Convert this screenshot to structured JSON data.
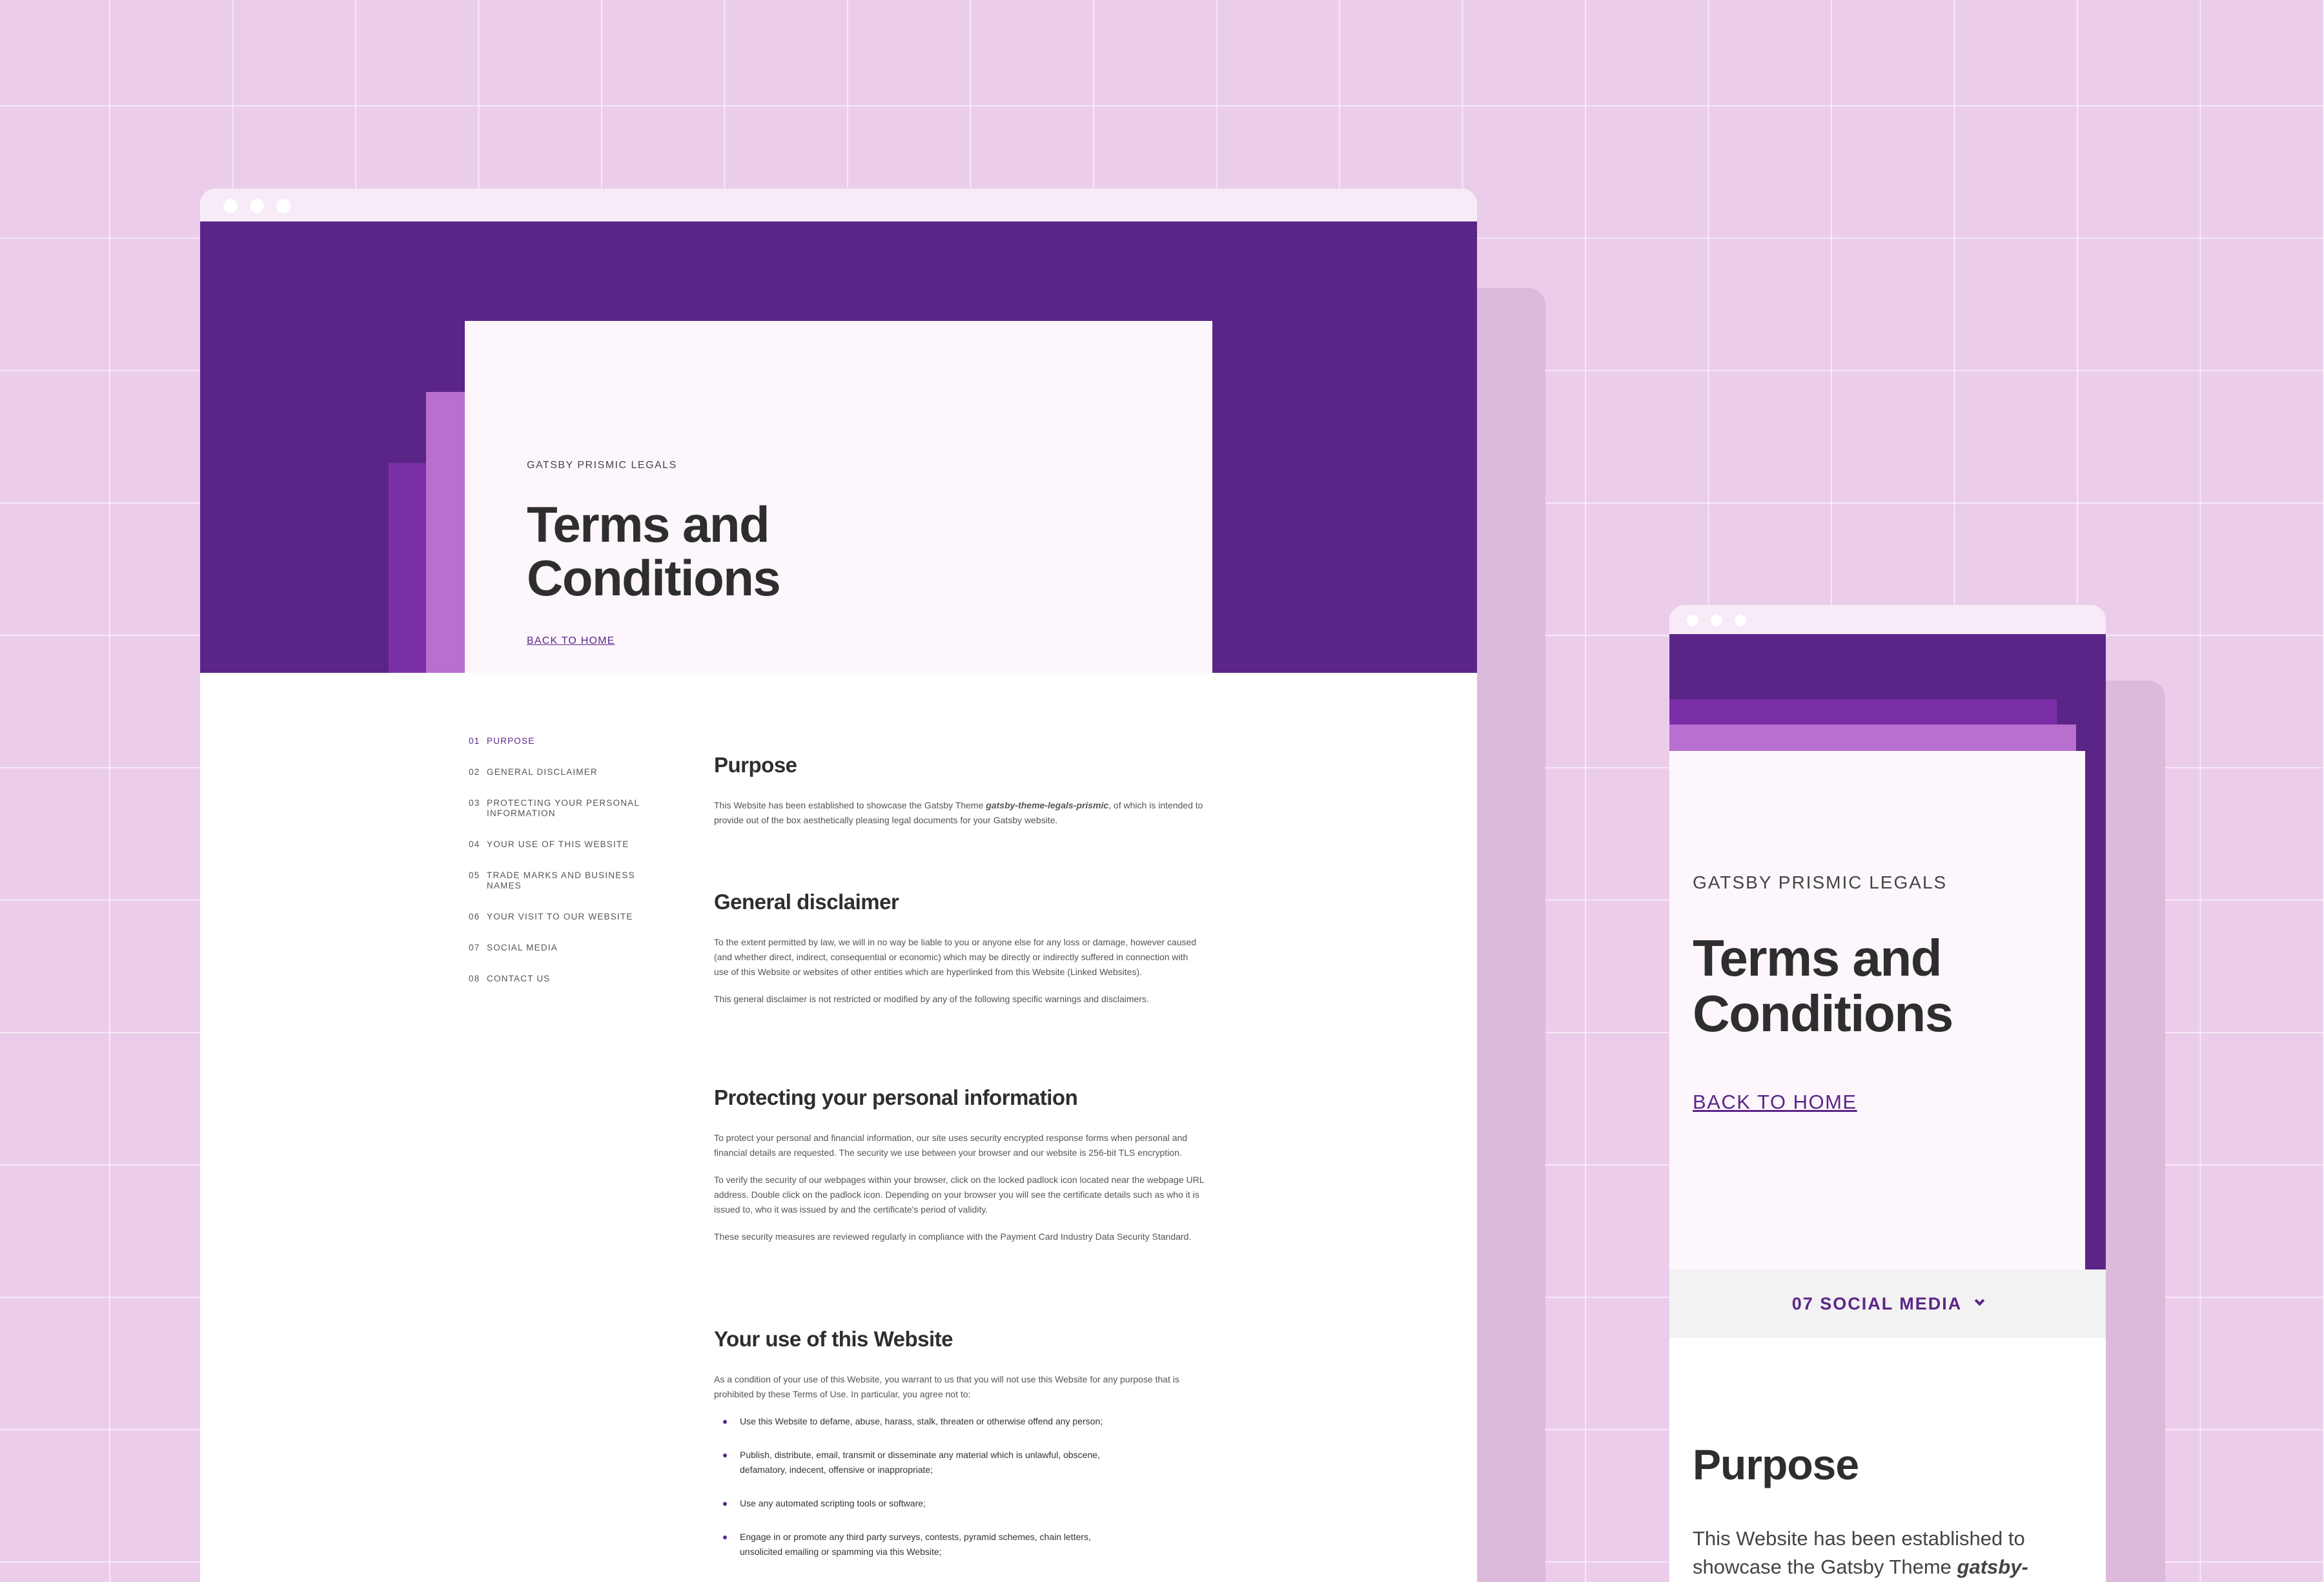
{
  "desktop": {
    "eyebrow": "GATSBY PRISMIC LEGALS",
    "title": "Terms and Conditions",
    "back_link": "BACK TO HOME",
    "toc": [
      {
        "num": "01",
        "label": "PURPOSE"
      },
      {
        "num": "02",
        "label": "GENERAL DISCLAIMER"
      },
      {
        "num": "03",
        "label": "PROTECTING YOUR PERSONAL INFORMATION"
      },
      {
        "num": "04",
        "label": "YOUR USE OF THIS WEBSITE"
      },
      {
        "num": "05",
        "label": "TRADE MARKS AND BUSINESS NAMES"
      },
      {
        "num": "06",
        "label": "YOUR VISIT TO OUR WEBSITE"
      },
      {
        "num": "07",
        "label": "SOCIAL MEDIA"
      },
      {
        "num": "08",
        "label": "CONTACT US"
      }
    ],
    "sections": {
      "purpose": {
        "heading": "Purpose",
        "p1_before": "This Website has been established to showcase the Gatsby Theme ",
        "p1_em": "gatsby-theme-legals-prismic",
        "p1_after": ", of which is intended to provide out of the box aesthetically pleasing legal documents for your Gatsby website."
      },
      "disclaimer": {
        "heading": "General disclaimer",
        "p1": "To the extent permitted by law, we will in no way be liable to you or anyone else for any loss or damage, however caused (and whether direct, indirect, consequential or economic) which may be directly or indirectly suffered in connection with use of this Website or websites of other entities which are hyperlinked from this Website (Linked Websites).",
        "p2": "This general disclaimer is not restricted or modified by any of the following specific warnings and disclaimers."
      },
      "protecting": {
        "heading": "Protecting your personal information",
        "p1": "To protect your personal and financial information, our site uses security encrypted response forms when personal and financial details are requested. The security we use between your browser and our website is 256-bit TLS encryption.",
        "p2": "To verify the security of our webpages within your browser, click on the locked padlock icon located near the webpage URL address. Double click on the padlock icon. Depending on your browser you will see the certificate details such as who it is issued to, who it was issued by and the certificate's period of validity.",
        "p3": "These security measures are reviewed regularly in compliance with the Payment Card Industry Data Security Standard."
      },
      "use": {
        "heading": "Your use of this Website",
        "p1": "As a condition of your use of this Website, you warrant to us that you will not use this Website for any purpose that is prohibited by these Terms of Use. In particular, you agree not to:",
        "bullets": [
          "Use this Website to defame, abuse, harass, stalk, threaten or otherwise offend any person;",
          "Publish, distribute, email, transmit or disseminate any material which is unlawful, obscene, defamatory, indecent, offensive or inappropriate;",
          "Use any automated scripting tools or software;",
          "Engage in or promote any third party surveys, contests, pyramid schemes, chain letters, unsolicited emailing or spamming via this Website;"
        ]
      }
    }
  },
  "mobile": {
    "eyebrow": "GATSBY PRISMIC LEGALS",
    "title": "Terms and Conditions",
    "back_link": "BACK TO HOME",
    "section_select": "07 SOCIAL MEDIA",
    "heading": "Purpose",
    "p_before": "This Website has been established to showcase the Gatsby Theme ",
    "p_em": "gatsby-theme-"
  }
}
